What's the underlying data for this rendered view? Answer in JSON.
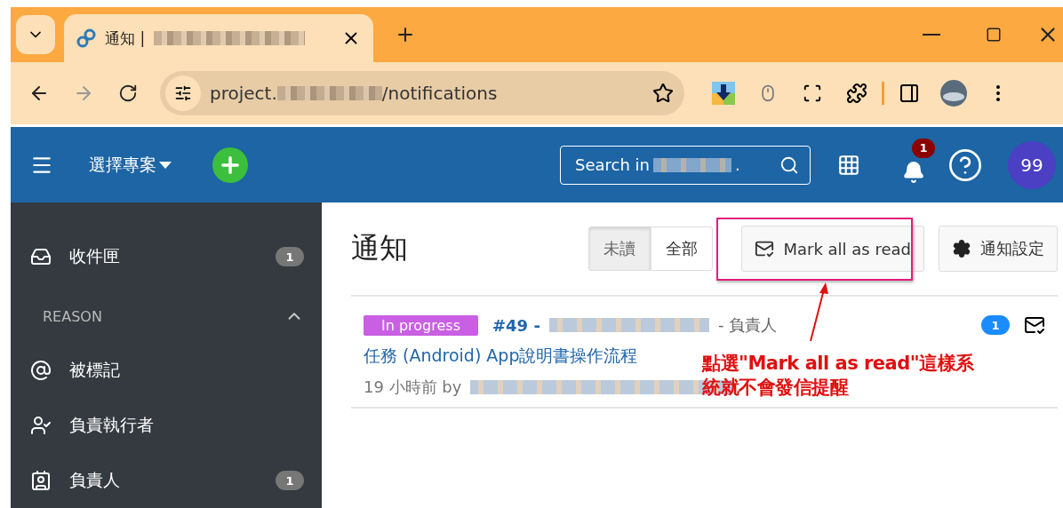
{
  "browser": {
    "tab_title": "通知 |",
    "url_prefix": "project.",
    "url_suffix": "/notifications"
  },
  "header": {
    "project_menu": "選擇專案",
    "search_placeholder": "Search in",
    "search_suffix": ".",
    "notification_count": "1",
    "avatar": "99"
  },
  "sidebar": {
    "items": [
      {
        "kind": "inbox",
        "label": "收件匣",
        "count": "1"
      }
    ],
    "section": {
      "title": "REASON",
      "expanded": true
    },
    "reasons": [
      {
        "kind": "mention",
        "label": "被標記"
      },
      {
        "kind": "assignee",
        "label": "負責執行者"
      },
      {
        "kind": "responsible",
        "label": "負責人",
        "count": "1"
      }
    ]
  },
  "main": {
    "title": "通知",
    "filters": [
      {
        "label": "未讀",
        "selected": true
      },
      {
        "label": "全部",
        "selected": false
      }
    ],
    "mark_all": "Mark all as read",
    "settings": "通知設定"
  },
  "notifications": [
    {
      "status": "In progress",
      "color": "#c95fe3",
      "number": "#49 -",
      "reason": "- 負責人",
      "subject": "任務 (Android) App說明書操作流程",
      "time": "19 小時前 by",
      "count": "1"
    }
  ],
  "annotation": {
    "text": "點選\"Mark all as read\"這樣系統就不會發信提醒"
  }
}
